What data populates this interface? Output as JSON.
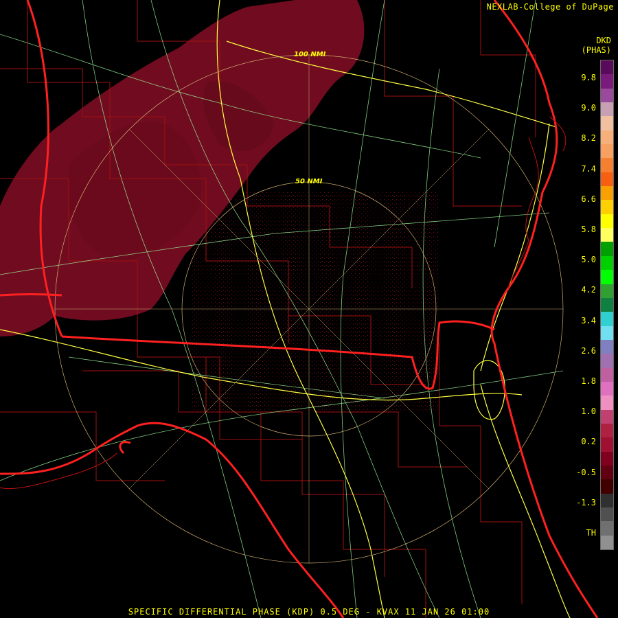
{
  "credit": "NEXLAB-College of DuPage",
  "product": {
    "code": "DKD",
    "units": "(PHAS)"
  },
  "rings": [
    {
      "label": "100 NMI"
    },
    {
      "label": "50 NMI"
    }
  ],
  "legend": {
    "labels": [
      "9.8",
      "9.0",
      "8.2",
      "7.4",
      "6.6",
      "5.8",
      "5.0",
      "4.2",
      "3.4",
      "2.6",
      "1.8",
      "1.0",
      "0.2",
      "-0.5",
      "-1.3",
      "TH"
    ],
    "colors": [
      "#5a0a5a",
      "#7a1a7a",
      "#9a4a9a",
      "#c8a0b4",
      "#f0c0a0",
      "#f7b07a",
      "#f7a060",
      "#f78030",
      "#f76010",
      "#f7a000",
      "#ffd000",
      "#ffff00",
      "#ffff60",
      "#00a000",
      "#00d000",
      "#00ff00",
      "#30a030",
      "#108040",
      "#30d0d0",
      "#70e0f0",
      "#8080c0",
      "#a070b0",
      "#c060a0",
      "#e070c0",
      "#f090c0",
      "#c04070",
      "#b02040",
      "#a01030",
      "#800020",
      "#600010",
      "#400000",
      "#303030",
      "#505050",
      "#707070",
      "#909090"
    ]
  },
  "caption": "SPECIFIC DIFFERENTIAL PHASE (KDP) 0.5 DEG - KVAX 11 JAN 26 01:00",
  "colors": {
    "state_line": "#ff2020",
    "county_line": "#a01010",
    "highway": "#ffff40",
    "road": "#a0ffa0",
    "range_ring": "#d0b070",
    "echo": "#8b0a20"
  }
}
